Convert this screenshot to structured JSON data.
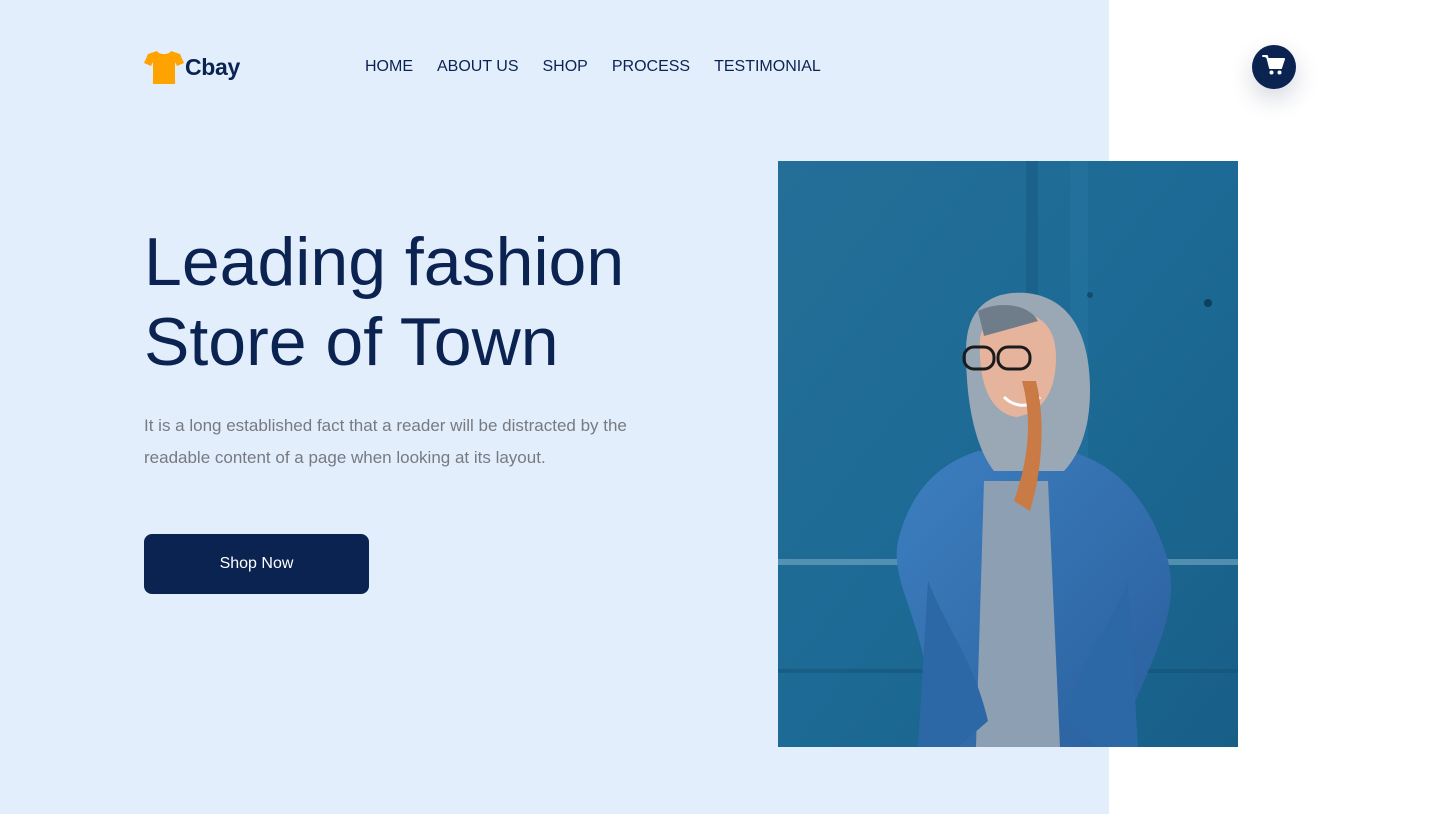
{
  "brand": {
    "name": "Cbay",
    "logo_icon": "tshirt-icon",
    "logo_color": "#ffa300"
  },
  "nav": {
    "items": [
      {
        "label": "HOME"
      },
      {
        "label": "ABOUT US"
      },
      {
        "label": "SHOP"
      },
      {
        "label": "PROCESS"
      },
      {
        "label": "TESTIMONIAL"
      }
    ]
  },
  "cart": {
    "icon": "shopping-cart-icon"
  },
  "hero": {
    "title_line1": "Leading fashion",
    "title_line2": "Store of Town",
    "description": "It is a long established fact that a reader will be distracted by the readable content of a page when looking at its layout.",
    "cta_label": "Shop Now",
    "image_subject": "woman-in-denim-jacket-photo"
  },
  "colors": {
    "primary": "#0b2350",
    "hero_background": "#e3eefd",
    "accent": "#ffa300",
    "body_text": "#777a80"
  }
}
